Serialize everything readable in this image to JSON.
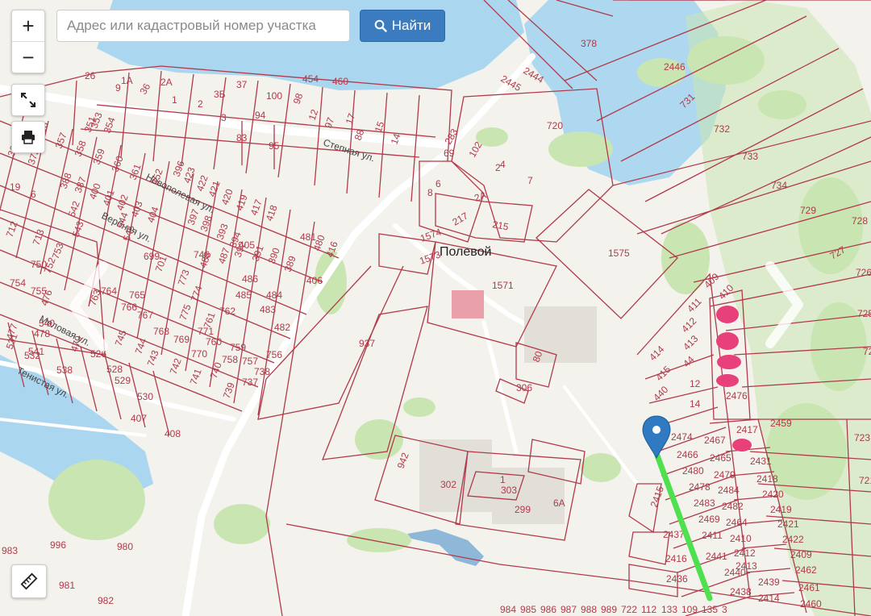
{
  "search": {
    "placeholder": "Адрес или кадастровый номер участка"
  },
  "find_button": {
    "label": "Найти"
  },
  "zoom": {
    "in_label": "+",
    "out_label": "−"
  },
  "colors": {
    "parcel_line": "#b03a4a",
    "water": "#aad6ef",
    "green": "#c9e6b2",
    "route": "#4fe04f",
    "marker": "#2f7ac0",
    "highlight": "#e8407a",
    "button": "#3b7bbf"
  },
  "map": {
    "settlement": "Полевой",
    "streets": [
      "Степная ул.",
      "Новополевая ул.",
      "Вербная ул.",
      "Меловая ул.",
      "Тенистая ул."
    ],
    "parcels": [
      "26",
      "1А",
      "9",
      "2А",
      "36",
      "1",
      "3Б",
      "2",
      "37",
      "100",
      "454",
      "460",
      "3",
      "94",
      "98",
      "12",
      "97",
      "17",
      "88",
      "15",
      "14",
      "83",
      "95",
      "356",
      "357",
      "358",
      "359",
      "360",
      "361",
      "352",
      "353",
      "354",
      "351",
      "365",
      "373",
      "378",
      "2444",
      "2445",
      "2446",
      "731",
      "732",
      "733",
      "734",
      "729",
      "728",
      "727",
      "726",
      "725",
      "724",
      "723",
      "721",
      "720",
      "283",
      "102",
      "69",
      "2",
      "4",
      "7",
      "8",
      "6",
      "2А",
      "217",
      "215",
      "1574",
      "1573",
      "1575",
      "1571",
      "937",
      "80",
      "306",
      "942",
      "302",
      "1",
      "303",
      "299",
      "6А",
      "19",
      "6",
      "712",
      "713",
      "750",
      "753",
      "752",
      "754",
      "755",
      "476",
      "477",
      "478",
      "479",
      "526",
      "528",
      "529",
      "530",
      "531",
      "532",
      "538",
      "540",
      "541",
      "542",
      "543",
      "544",
      "545",
      "699",
      "701",
      "773",
      "774",
      "775",
      "771",
      "770",
      "769",
      "768",
      "767",
      "766",
      "765",
      "764",
      "763",
      "762",
      "761",
      "760",
      "759",
      "758",
      "757",
      "756",
      "738",
      "737",
      "739",
      "740",
      "741",
      "742",
      "743",
      "744",
      "745",
      "746",
      "488",
      "487",
      "486",
      "485",
      "484",
      "483",
      "482",
      "481",
      "480",
      "416",
      "417",
      "418",
      "419",
      "420",
      "421",
      "422",
      "423",
      "396",
      "397",
      "398",
      "393",
      "394",
      "392",
      "391",
      "390",
      "389",
      "388",
      "387",
      "400",
      "401",
      "402",
      "403",
      "404",
      "405",
      "406",
      "407",
      "408",
      "409",
      "410",
      "411",
      "412",
      "413",
      "414",
      "415",
      "440",
      "44",
      "12",
      "14",
      "2476",
      "2474",
      "2467",
      "2466",
      "2465",
      "2480",
      "2479",
      "2478",
      "2484",
      "2483",
      "2482",
      "2469",
      "2464",
      "2411",
      "2410",
      "2441",
      "2412",
      "2440",
      "2413",
      "2439",
      "2414",
      "2438",
      "2415",
      "2437",
      "2416",
      "2436",
      "2417",
      "2431",
      "2418",
      "2420",
      "2419",
      "2421",
      "2422",
      "2409",
      "2462",
      "2461",
      "2460",
      "2459",
      "996",
      "980",
      "981",
      "982",
      "983",
      "984",
      "985",
      "986",
      "987",
      "988",
      "989",
      "722",
      "112",
      "133",
      "109",
      "135",
      "3"
    ]
  }
}
